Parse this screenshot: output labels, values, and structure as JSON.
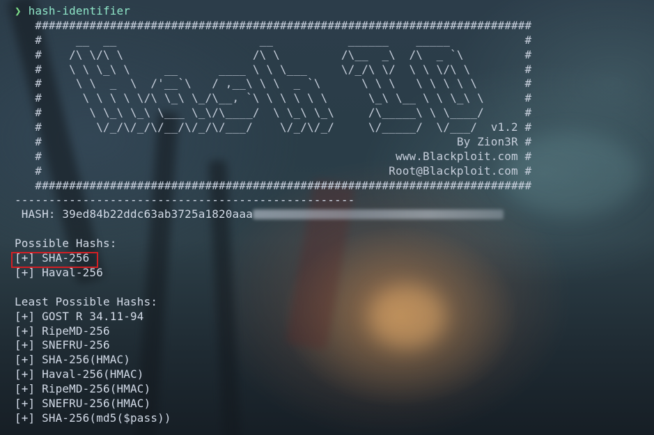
{
  "prompt": {
    "symbol": "❯",
    "command": "hash-identifier"
  },
  "banner": [
    "   #########################################################################",
    "   #     __  __                     __           ______    _____           #",
    "   #    /\\ \\/\\ \\                   /\\ \\         /\\__  _\\  /\\  _ `\\         #",
    "   #    \\ \\ \\_\\ \\     __      ____ \\ \\ \\___     \\/_/\\ \\/  \\ \\ \\/\\ \\        #",
    "   #     \\ \\  _  \\  /'__`\\   / ,__\\ \\ \\  _ `\\      \\ \\ \\   \\ \\ \\ \\ \\       #",
    "   #      \\ \\ \\ \\ \\/\\ \\_\\ \\_/\\__, `\\ \\ \\ \\ \\ \\      \\_\\ \\__ \\ \\ \\_\\ \\      #",
    "   #       \\ \\_\\ \\_\\ \\___ \\_\\/\\____/  \\ \\_\\ \\_\\     /\\_____\\ \\ \\____/      #",
    "   #        \\/_/\\/_/\\/__/\\/_/\\/___/    \\/_/\\/_/     \\/_____/  \\/___/  v1.2 #",
    "   #                                                             By Zion3R #",
    "   #                                                    www.Blackploit.com #",
    "   #                                                   Root@Blackploit.com #",
    "   #########################################################################"
  ],
  "separator": "--------------------------------------------------",
  "hash": {
    "label": " HASH: ",
    "value": "39ed84b22ddc63ab3725a1820aaa"
  },
  "possible": {
    "heading": "Possible Hashs:",
    "items": [
      "[+] SHA-256",
      "[+] Haval-256"
    ]
  },
  "least": {
    "heading": "Least Possible Hashs:",
    "items": [
      "[+] GOST R 34.11-94",
      "[+] RipeMD-256",
      "[+] SNEFRU-256",
      "[+] SHA-256(HMAC)",
      "[+] Haval-256(HMAC)",
      "[+] RipeMD-256(HMAC)",
      "[+] SNEFRU-256(HMAC)",
      "[+] SHA-256(md5($pass))"
    ]
  },
  "colors": {
    "prompt": "#7ee08a",
    "command": "#8fe6c8",
    "text": "#d3dbe8",
    "highlight": "#d41f24"
  }
}
